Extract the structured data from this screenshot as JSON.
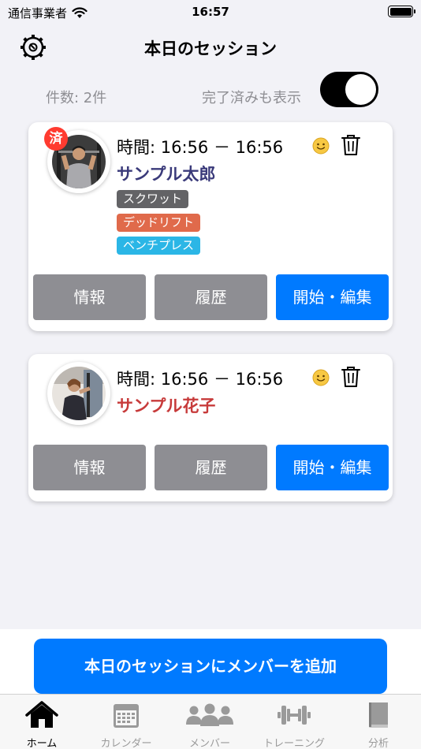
{
  "status_bar": {
    "carrier": "通信事業者",
    "time": "16:57"
  },
  "header": {
    "title": "本日のセッション"
  },
  "filter": {
    "count": "件数: 2件",
    "show_completed_label": "完了済みも表示",
    "show_completed_on": true
  },
  "sessions": [
    {
      "time": "時間: 16:56 － 16:56",
      "name": "サンプル太郎",
      "name_color": "#3a3a7a",
      "done_badge": "済",
      "tags": [
        {
          "label": "スクワット",
          "color": "#636366"
        },
        {
          "label": "デッドリフト",
          "color": "#e06a4b"
        },
        {
          "label": "ベンチプレス",
          "color": "#2bb6e6"
        }
      ],
      "buttons": {
        "info": "情報",
        "history": "履歴",
        "edit": "開始・編集"
      }
    },
    {
      "time": "時間: 16:56 － 16:56",
      "name": "サンプル花子",
      "name_color": "#c73a3a",
      "tags": [],
      "buttons": {
        "info": "情報",
        "history": "履歴",
        "edit": "開始・編集"
      }
    }
  ],
  "add_button": "本日のセッションにメンバーを追加",
  "tabs": [
    {
      "label": "ホーム",
      "icon": "home-icon",
      "active": true
    },
    {
      "label": "カレンダー",
      "icon": "calendar-icon",
      "active": false
    },
    {
      "label": "メンバー",
      "icon": "members-icon",
      "active": false
    },
    {
      "label": "トレーニング",
      "icon": "dumbbell-icon",
      "active": false
    },
    {
      "label": "分析",
      "icon": "book-icon",
      "active": false
    }
  ],
  "colors": {
    "accent": "#007aff",
    "secondary_button": "#8e8e93",
    "badge": "#ff3b30"
  }
}
